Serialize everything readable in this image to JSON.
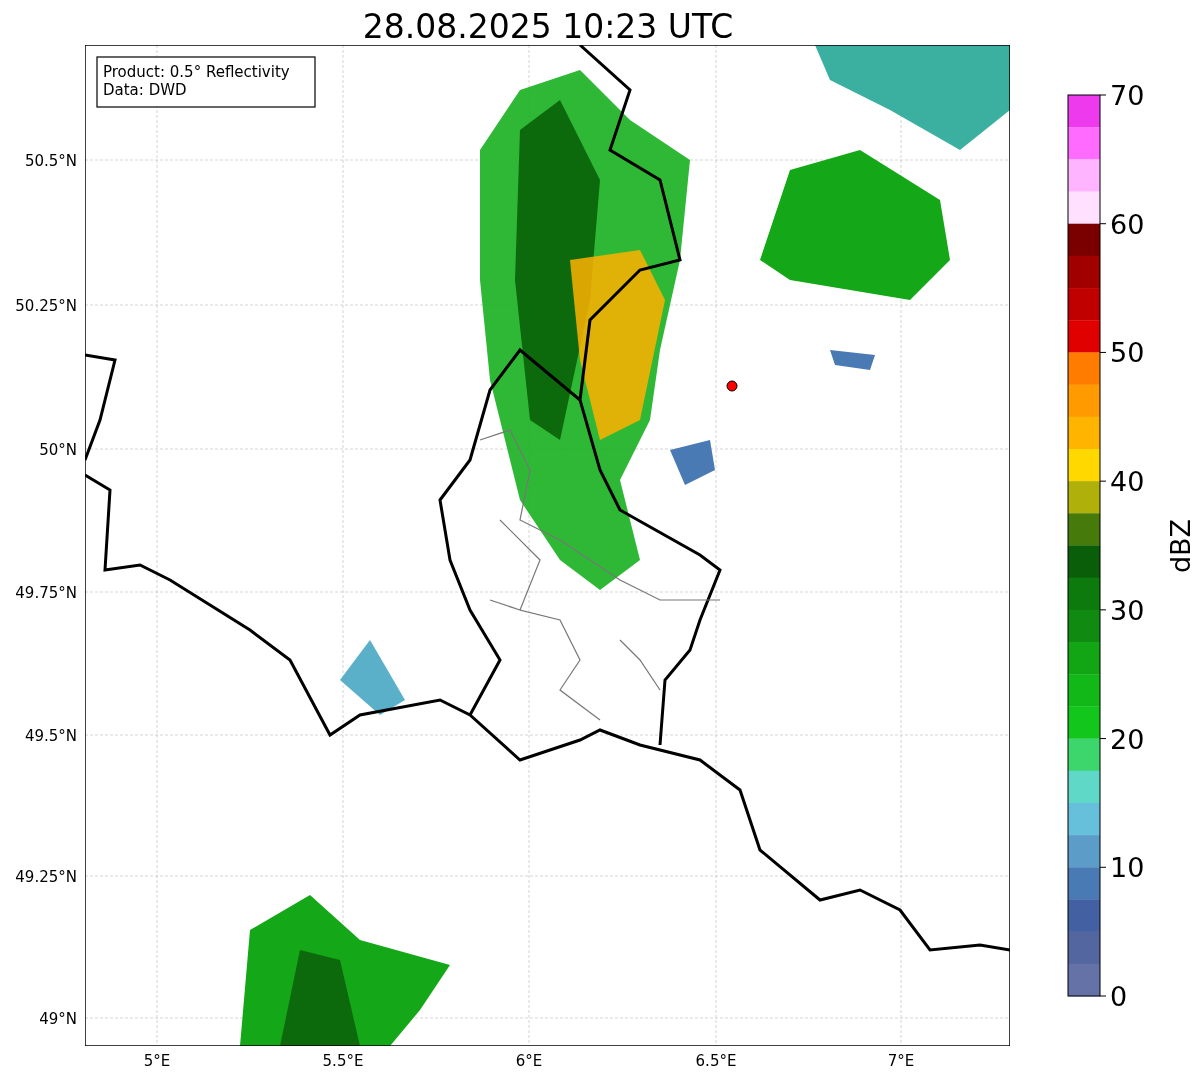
{
  "title": "28.08.2025 10:23 UTC",
  "info_box": {
    "lines": [
      "Product: 0.5° Reflectivity",
      "Data: DWD"
    ]
  },
  "map": {
    "x_ticks": [
      {
        "label": "5°E"
      },
      {
        "label": "5.5°E"
      },
      {
        "label": "6°E"
      },
      {
        "label": "6.5°E"
      },
      {
        "label": "7°E"
      }
    ],
    "y_ticks": [
      {
        "label": "50.5°N"
      },
      {
        "label": "50.25°N"
      },
      {
        "label": "50°N"
      },
      {
        "label": "49.75°N"
      },
      {
        "label": "49.5°N"
      },
      {
        "label": "49.25°N"
      },
      {
        "label": "49°N"
      }
    ]
  },
  "colorbar": {
    "label": "dBZ",
    "ticks": [
      "70",
      "60",
      "50",
      "40",
      "30",
      "20",
      "10",
      "0"
    ],
    "segments": [
      {
        "color": "#ec3aec"
      },
      {
        "color": "#ff6aff"
      },
      {
        "color": "#ffb4ff"
      },
      {
        "color": "#ffe0ff"
      },
      {
        "color": "#7a0000"
      },
      {
        "color": "#a00000"
      },
      {
        "color": "#c00000"
      },
      {
        "color": "#e00000"
      },
      {
        "color": "#ff7c00"
      },
      {
        "color": "#ff9a00"
      },
      {
        "color": "#ffb400"
      },
      {
        "color": "#ffd800"
      },
      {
        "color": "#b0b00a"
      },
      {
        "color": "#467a0a"
      },
      {
        "color": "#0a5e0a"
      },
      {
        "color": "#0c7a0c"
      },
      {
        "color": "#108a10"
      },
      {
        "color": "#12a614"
      },
      {
        "color": "#12b818"
      },
      {
        "color": "#12c61c"
      },
      {
        "color": "#3cd66c"
      },
      {
        "color": "#60d8c8"
      },
      {
        "color": "#66c0dc"
      },
      {
        "color": "#5c9cc8"
      },
      {
        "color": "#4a7ab4"
      },
      {
        "color": "#4360a2"
      },
      {
        "color": "#5366a0"
      },
      {
        "color": "#6472a8"
      }
    ]
  }
}
